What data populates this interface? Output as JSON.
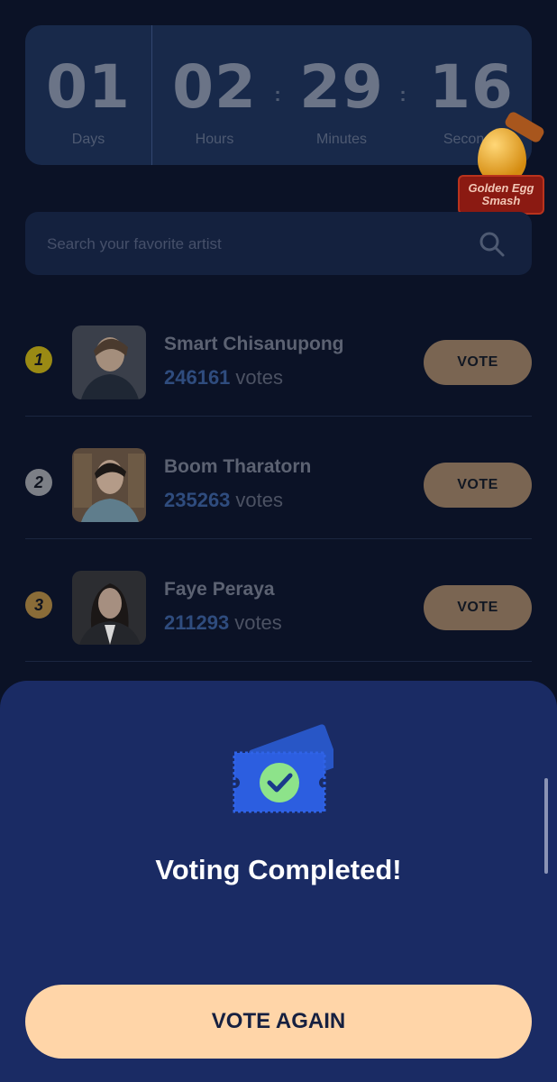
{
  "countdown": {
    "days": {
      "value": "01",
      "label": "Days"
    },
    "hours": {
      "value": "02",
      "label": "Hours"
    },
    "minutes": {
      "value": "29",
      "label": "Minutes"
    },
    "seconds": {
      "value": "16",
      "label": "Seconds"
    },
    "separator": ":"
  },
  "promo_badge": {
    "line1": "Golden Egg",
    "line2": "Smash"
  },
  "search": {
    "placeholder": "Search your favorite artist",
    "icon": "search-icon"
  },
  "artists": [
    {
      "rank": "1",
      "name": "Smart Chisanupong",
      "votes": "246161",
      "votes_unit": "votes",
      "vote_label": "VOTE",
      "rank_color": "#9a8a14"
    },
    {
      "rank": "2",
      "name": "Boom Tharatorn",
      "votes": "235263",
      "votes_unit": "votes",
      "vote_label": "VOTE",
      "rank_color": "#7c7f86"
    },
    {
      "rank": "3",
      "name": "Faye Peraya",
      "votes": "211293",
      "votes_unit": "votes",
      "vote_label": "VOTE",
      "rank_color": "#8a6c38"
    }
  ],
  "modal": {
    "title": "Voting Completed!",
    "icon": "ticket-check-icon",
    "button_label": "VOTE AGAIN"
  },
  "colors": {
    "background": "#0b1226",
    "sheet": "#1a2b64",
    "accent_button": "#ffd5a8",
    "check": "#8de38a"
  }
}
